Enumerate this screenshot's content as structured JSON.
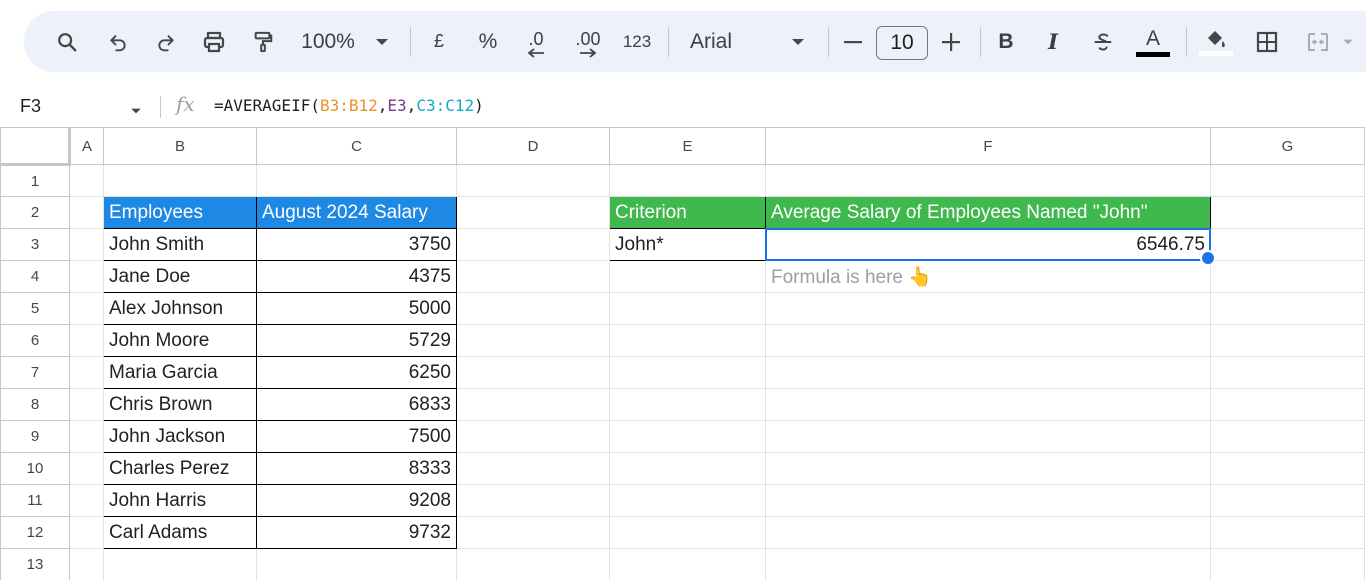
{
  "toolbar": {
    "zoom": "100%",
    "currency": "£",
    "percent": "%",
    "decrease_decimal": ".0",
    "increase_decimal": ".00",
    "number_format": "123",
    "font": "Arial",
    "font_size": "10",
    "bold": "B",
    "italic": "I",
    "text_color_letter": "A"
  },
  "formula_bar": {
    "cell_ref": "F3",
    "fx": "fx",
    "formula_prefix": "=AVERAGEIF(",
    "range1": "B3:B12",
    "comma1": ",",
    "criterion_ref": "E3",
    "comma2": ",",
    "range2": "C3:C12",
    "formula_suffix": ")"
  },
  "columns": [
    "A",
    "B",
    "C",
    "D",
    "E",
    "F",
    "G"
  ],
  "rows": [
    "1",
    "2",
    "3",
    "4",
    "5",
    "6",
    "7",
    "8",
    "9",
    "10",
    "11",
    "12",
    "13"
  ],
  "table": {
    "header_name": "Employees",
    "header_salary": "August 2024 Salary",
    "employees": [
      {
        "name": "John Smith",
        "salary": "3750"
      },
      {
        "name": "Jane Doe",
        "salary": "4375"
      },
      {
        "name": "Alex Johnson",
        "salary": "5000"
      },
      {
        "name": "John Moore",
        "salary": "5729"
      },
      {
        "name": "Maria Garcia",
        "salary": "6250"
      },
      {
        "name": "Chris Brown",
        "salary": "6833"
      },
      {
        "name": "John Jackson",
        "salary": "7500"
      },
      {
        "name": "Charles Perez",
        "salary": "8333"
      },
      {
        "name": "John Harris",
        "salary": "9208"
      },
      {
        "name": "Carl Adams",
        "salary": "9732"
      }
    ]
  },
  "result": {
    "criterion_header": "Criterion",
    "average_header": "Average Salary of Employees Named \"John\"",
    "criterion_value": "John*",
    "average_value": "6546.75",
    "note": "Formula is here 👆"
  },
  "colors": {
    "toolbar_bg": "#edf2fa",
    "header_blue": "#1e88e5",
    "header_green": "#3fb84d",
    "selection": "#1a73e8"
  }
}
